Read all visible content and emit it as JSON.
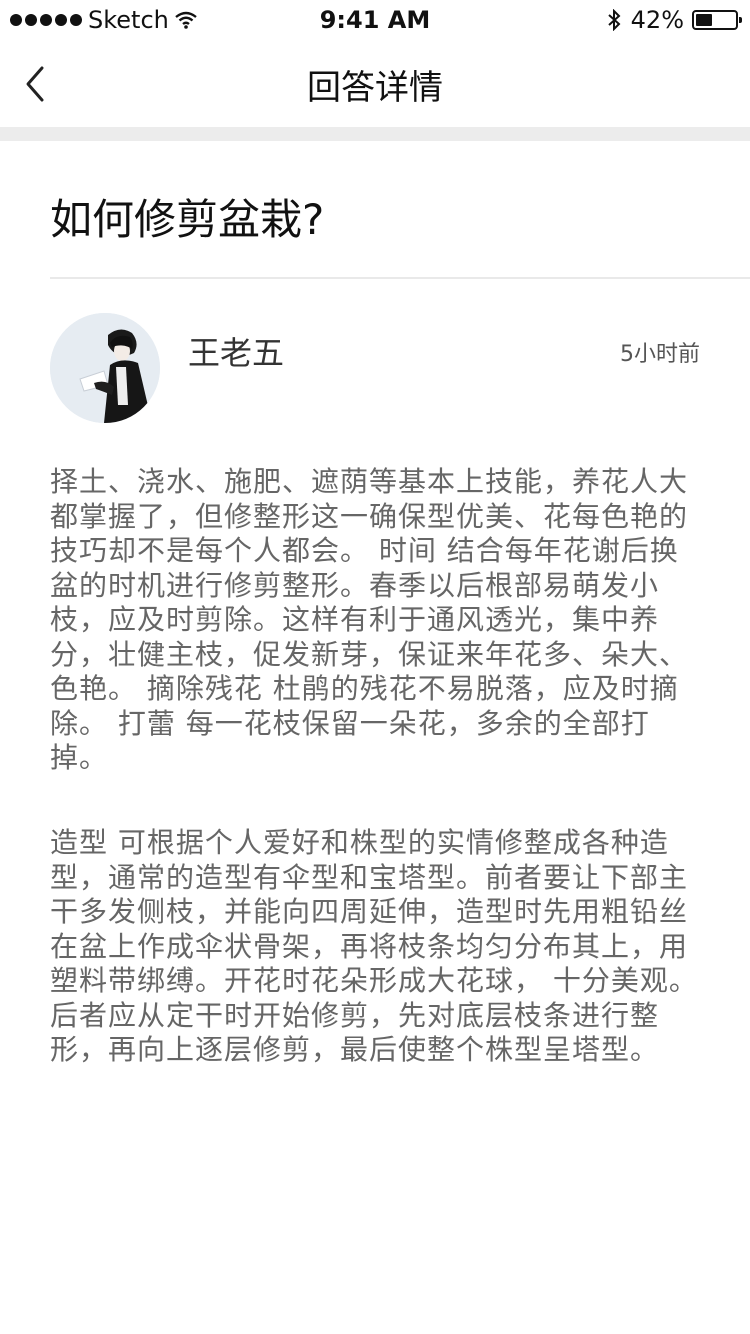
{
  "status_bar": {
    "carrier": "Sketch",
    "time": "9:41 AM",
    "battery": "42%",
    "battery_level": 0.42
  },
  "nav": {
    "title": "回答详情",
    "back_icon": "chevron-left-icon"
  },
  "question": {
    "title": "如何修剪盆栽?"
  },
  "answer": {
    "author": "王老五",
    "time_ago": "5小时前",
    "paragraphs": [
      "择土、浇水、施肥、遮荫等基本上技能，养花人大都掌握了，但修整形这一确保型优美、花每色艳的技巧却不是每个人都会。 时间 结合每年花谢后换盆的时机进行修剪整形。春季以后根部易萌发小枝，应及时剪除。这样有利于通风透光，集中养分，壮健主枝，促发新芽，保证来年花多、朵大、色艳。 摘除残花 杜鹃的残花不易脱落，应及时摘除。 打蕾 每一花枝保留一朵花，多余的全部打掉。",
      "造型  可根据个人爱好和株型的实情修整成各种造型，通常的造型有伞型和宝塔型。前者要让下部主干多发侧枝，并能向四周延伸，造型时先用粗铅丝在盆上作成伞状骨架，再将枝条均匀分布其上，用塑料带绑缚。开花时花朵形成大花球， 十分美观。后者应从定干时开始修剪，先对底层枝条进行整形，再向上逐层修剪，最后使整个株型呈塔型。"
    ]
  }
}
